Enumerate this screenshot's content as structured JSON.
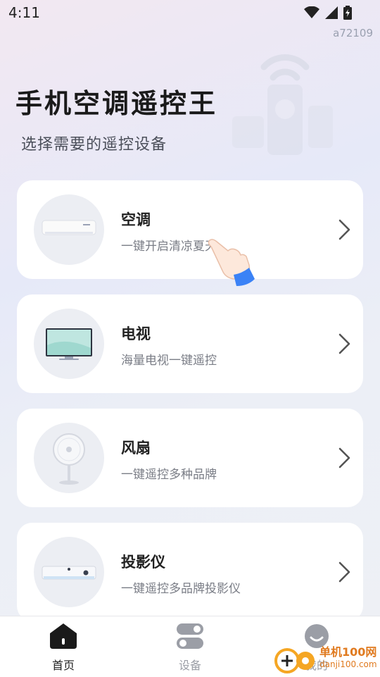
{
  "status_bar": {
    "time": "4:11"
  },
  "watermark_id": "a72109",
  "app_title": "手机空调遥控王",
  "app_subtitle": "选择需要的遥控设备",
  "devices": [
    {
      "name": "空调",
      "desc": "一键开启清凉夏天",
      "icon": "air-conditioner"
    },
    {
      "name": "电视",
      "desc": "海量电视一键遥控",
      "icon": "tv"
    },
    {
      "name": "风扇",
      "desc": "一键遥控多种品牌",
      "icon": "fan"
    },
    {
      "name": "投影仪",
      "desc": "一键遥控多品牌投影仪",
      "icon": "projector"
    }
  ],
  "nav": [
    {
      "label": "首页",
      "icon": "home-icon",
      "active": true
    },
    {
      "label": "设备",
      "icon": "toggle-icon",
      "active": false
    },
    {
      "label": "我的",
      "icon": "profile-icon",
      "active": false
    }
  ],
  "brand_watermark": {
    "name": "单机100网",
    "url": "danji100.com"
  },
  "colors": {
    "accent": "#1a1a1a",
    "card_bg": "#ffffff",
    "muted": "#7a7d86",
    "hand_cuff": "#3b82f6"
  }
}
